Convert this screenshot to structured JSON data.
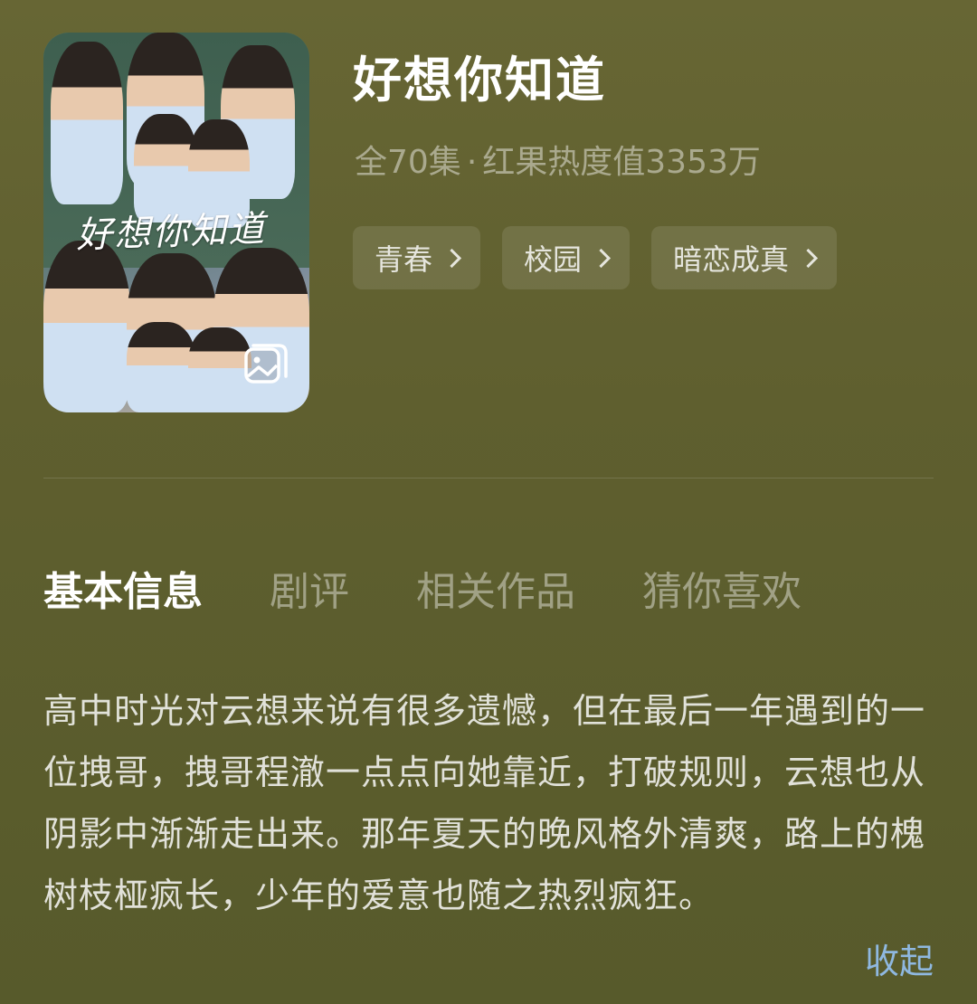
{
  "drama": {
    "title": "好想你知道",
    "poster_overlay_text": "好想你知道",
    "episodes": "全70集",
    "separator": "·",
    "heat": "红果热度值3353万",
    "tags": [
      "青春",
      "校园",
      "暗恋成真"
    ]
  },
  "tabs": [
    {
      "label": "基本信息",
      "active": true
    },
    {
      "label": "剧评",
      "active": false
    },
    {
      "label": "相关作品",
      "active": false
    },
    {
      "label": "猜你喜欢",
      "active": false
    }
  ],
  "description": "高中时光对云想来说有很多遗憾，但在最后一年遇到的一位拽哥，拽哥程澈一点点向她靠近，打破规则，云想也从阴影中渐渐走出来。那年夏天的晚风格外清爽，路上的槐树枝桠疯长，少年的爱意也随之热烈疯狂。",
  "collapse_label": "收起",
  "colors": {
    "background": "#626233",
    "link": "#8fb8e0",
    "active_tab": "#ffffff",
    "inactive_tab": "rgba(255,255,255,0.42)"
  },
  "icons": {
    "poster_gallery": "gallery-icon",
    "tag_chevron": "chevron-right-icon"
  }
}
